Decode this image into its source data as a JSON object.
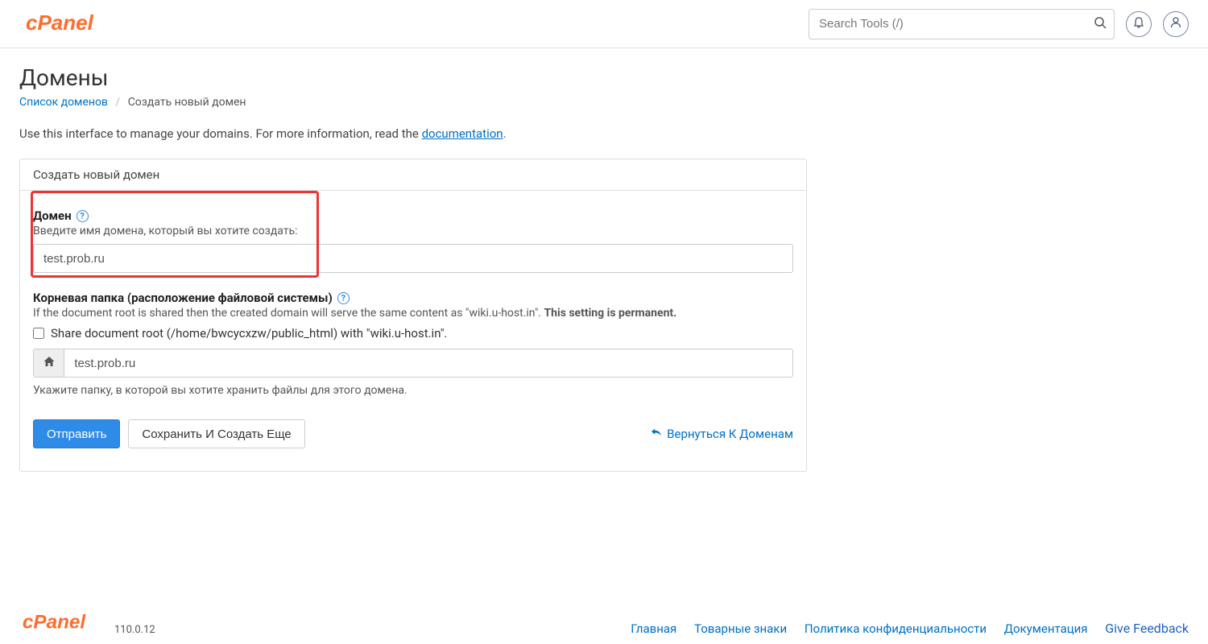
{
  "header": {
    "search_placeholder": "Search Tools (/)"
  },
  "page": {
    "title": "Домены",
    "breadcrumb": {
      "list_link": "Список доменов",
      "current": "Создать новый домен"
    },
    "intro_prefix": "Use this interface to manage your domains. For more information, read the ",
    "intro_link": "documentation",
    "intro_suffix": "."
  },
  "form": {
    "panel_title": "Создать новый домен",
    "domain": {
      "label": "Домен",
      "help": "Введите имя домена, который вы хотите создать:",
      "value": "test.prob.ru"
    },
    "docroot": {
      "label": "Корневая папка (расположение файловой системы)",
      "shared_help_prefix": "If the document root is shared then the created domain will serve the same content as \"wiki.u-host.in\". ",
      "shared_help_bold": "This setting is permanent.",
      "share_checkbox_label": "Share document root (/home/bwcycxzw/public_html) with \"wiki.u-host.in\".",
      "path_value": "test.prob.ru",
      "path_help": "Укажите папку, в которой вы хотите хранить файлы для этого домена."
    },
    "buttons": {
      "submit": "Отправить",
      "save_more": "Сохранить И Создать Еще",
      "back": "Вернуться К Доменам"
    }
  },
  "footer": {
    "version": "110.0.12",
    "links": {
      "home": "Главная",
      "trademarks": "Товарные знаки",
      "privacy": "Политика конфиденциальности",
      "docs": "Документация",
      "feedback": "Give Feedback"
    }
  }
}
